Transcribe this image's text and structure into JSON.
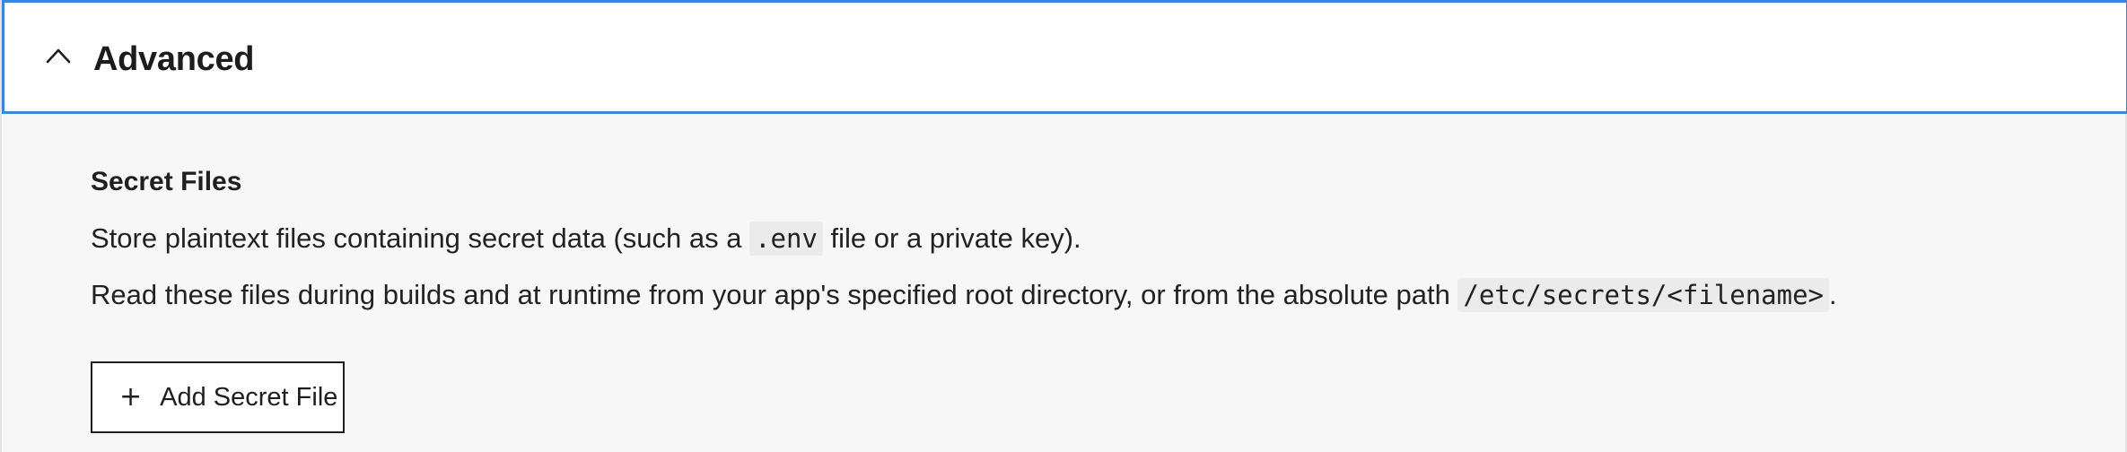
{
  "accordion": {
    "title": "Advanced",
    "chevron_icon": "chevron-up-icon",
    "expanded": true,
    "accent_color": "#3b86d8"
  },
  "secret_files": {
    "title": "Secret Files",
    "line1": {
      "before": "Store plaintext files containing secret data (such as a ",
      "code": ".env",
      "after": " file or a private key)."
    },
    "line2": {
      "before": "Read these files during builds and at runtime from your app's specified root directory, or from the absolute path ",
      "code": "/etc/secrets/<filename>",
      "after": "."
    },
    "add_button": {
      "icon": "plus-icon",
      "label": "Add Secret File"
    }
  }
}
